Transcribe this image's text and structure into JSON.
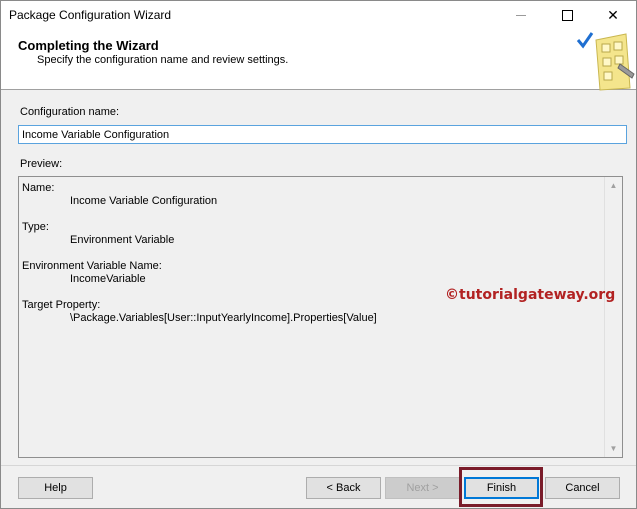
{
  "window": {
    "title": "Package Configuration Wizard"
  },
  "header": {
    "title": "Completing the Wizard",
    "subtitle": "Specify the configuration name and review settings."
  },
  "config_name": {
    "label": "Configuration name:",
    "value": "Income Variable Configuration"
  },
  "preview": {
    "label": "Preview:",
    "entries": [
      {
        "heading": "Name:",
        "value": "Income Variable Configuration"
      },
      {
        "heading": "Type:",
        "value": "Environment Variable"
      },
      {
        "heading": "Environment Variable Name:",
        "value": "IncomeVariable"
      },
      {
        "heading": "Target Property:",
        "value": "\\Package.Variables[User::InputYearlyIncome].Properties[Value]"
      }
    ]
  },
  "watermark": "©tutorialgateway.org",
  "buttons": {
    "help": "Help",
    "back": "< Back",
    "next": "Next >",
    "finish": "Finish",
    "cancel": "Cancel"
  },
  "colors": {
    "accent": "#0078d7",
    "watermark": "#b22222",
    "highlight": "#7a1c2a"
  }
}
